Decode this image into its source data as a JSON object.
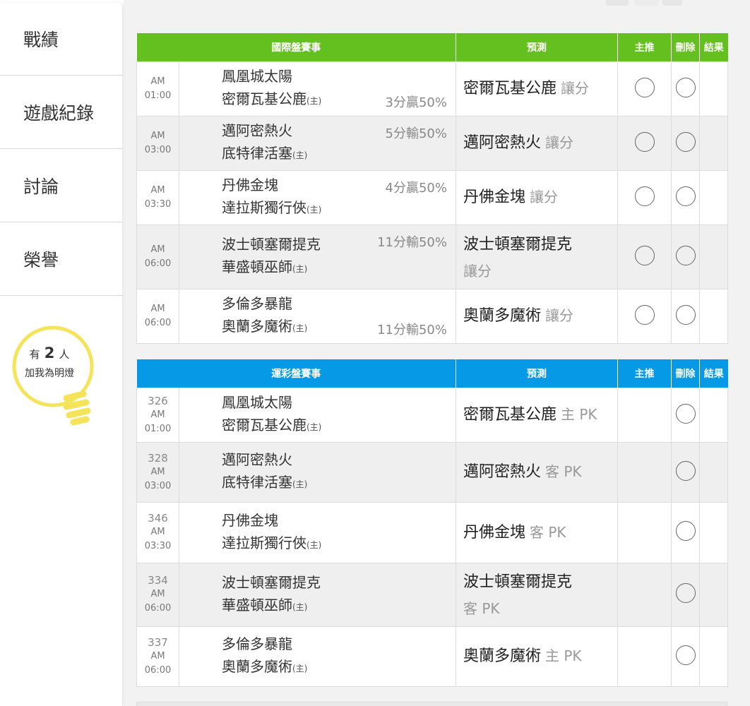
{
  "sidebar": {
    "items": [
      {
        "label": "戰績"
      },
      {
        "label": "遊戲紀錄"
      },
      {
        "label": "討論"
      },
      {
        "label": "榮譽"
      }
    ],
    "bulb": {
      "prefix": "有",
      "count": "2",
      "suffix": "人",
      "caption": "加我為明燈"
    }
  },
  "colors": {
    "intl_header": "#63c01e",
    "lottery_header": "#0599e6",
    "bulb": "#f5e35a"
  },
  "intl": {
    "headers": {
      "game": "國際盤賽事",
      "pred": "預測",
      "main": "主推",
      "del": "刪除",
      "res": "結果"
    },
    "rows": [
      {
        "time": "AM 01:00",
        "team1": "鳳凰城太陽",
        "team2": "密爾瓦基公鹿",
        "host": "(主)",
        "odds": "3分贏50%",
        "odds_row": 2,
        "pred": "密爾瓦基公鹿",
        "tag": "讓分"
      },
      {
        "time": "AM\n03:00",
        "team1": "邁阿密熱火",
        "team2": "底特律活塞",
        "host": "(主)",
        "odds": "5分輸50%",
        "odds_row": 1,
        "pred": "邁阿密熱火",
        "tag": "讓分"
      },
      {
        "time": "AM\n03:30",
        "team1": "丹佛金塊",
        "team2": "達拉斯獨行俠",
        "host": "(主)",
        "odds": "4分贏50%",
        "odds_row": 1,
        "pred": "丹佛金塊",
        "tag": "讓分"
      },
      {
        "time": "AM\n06:00",
        "team1": "波士頓塞爾提克",
        "team2": "華盛頓巫師",
        "host": "(主)",
        "odds": "11分輸50%",
        "odds_row": 1,
        "pred": "波士頓塞爾提克",
        "tag": "讓分"
      },
      {
        "time": "AM\n06:00",
        "team1": "多倫多暴龍",
        "team2": "奧蘭多魔術",
        "host": "(主)",
        "odds": "11分輸50%",
        "odds_row": 2,
        "pred": "奧蘭多魔術",
        "tag": "讓分"
      }
    ]
  },
  "lottery": {
    "headers": {
      "game": "運彩盤賽事",
      "pred": "預測",
      "main": "主推",
      "del": "刪除",
      "res": "結果"
    },
    "rows": [
      {
        "code": "326",
        "time": "AM 01:00",
        "team1": "鳳凰城太陽",
        "team2": "密爾瓦基公鹿",
        "host": "(主)",
        "pred": "密爾瓦基公鹿",
        "tag": "主 PK"
      },
      {
        "code": "328",
        "time": "AM\n03:00",
        "team1": "邁阿密熱火",
        "team2": "底特律活塞",
        "host": "(主)",
        "pred": "邁阿密熱火",
        "tag": "客 PK"
      },
      {
        "code": "346",
        "time": "AM\n03:30",
        "team1": "丹佛金塊",
        "team2": "達拉斯獨行俠",
        "host": "(主)",
        "pred": "丹佛金塊",
        "tag": "客 PK"
      },
      {
        "code": "334",
        "time": "AM\n06:00",
        "team1": "波士頓塞爾提克",
        "team2": "華盛頓巫師",
        "host": "(主)",
        "pred": "波士頓塞爾提克",
        "tag": "客 PK"
      },
      {
        "code": "337",
        "time": "AM\n06:00",
        "team1": "多倫多暴龍",
        "team2": "奧蘭多魔術",
        "host": "(主)",
        "pred": "奧蘭多魔術",
        "tag": "主 PK"
      }
    ]
  }
}
